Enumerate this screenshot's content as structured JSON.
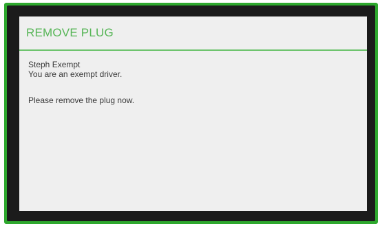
{
  "dialog": {
    "title": "REMOVE PLUG",
    "driver_name": "Steph Exempt",
    "status_message": "You are an exempt driver.",
    "instruction": "Please remove the plug now."
  },
  "colors": {
    "frame": "#2ea82e",
    "title": "#56b556",
    "divider": "#6cc36c",
    "background": "#efefef"
  }
}
